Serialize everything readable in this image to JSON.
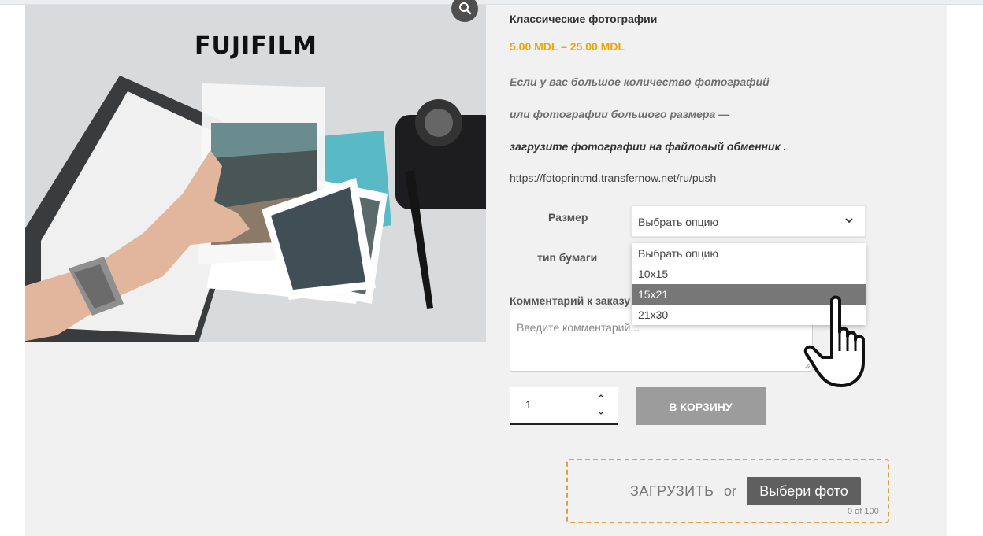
{
  "product": {
    "title": "Классические фотографии",
    "price": "5.00 MDL – 25.00 MDL",
    "info_line1": "Если у вас большое количество фотографий",
    "info_line2": "или фотографии большого размера —",
    "info_line3": "загрузите фотографии на файловый обменник .",
    "upload_link": "https://fotoprintmd.transfernow.net/ru/push",
    "image_logo_text": "FUJIFILM"
  },
  "options": {
    "size_label": "Размер",
    "size_selected": "Выбрать опцию",
    "paper_label": "тип бумаги",
    "dropdown": [
      "Выбрать опцию",
      "10x15",
      "15x21",
      "21x30"
    ],
    "dropdown_highlighted_index": 2
  },
  "comment": {
    "label": "Комментарий к заказу",
    "placeholder": "Введите комментарий..."
  },
  "cart": {
    "quantity": "1",
    "add_label": "В КОРЗИНУ"
  },
  "upload": {
    "label": "ЗАГРУЗИТЬ",
    "or": "or",
    "button": "Выбери фото",
    "count": "0 of 100"
  },
  "colors": {
    "price": "#f0a500",
    "panel": "#f1f1f1",
    "highlight": "#777777",
    "dashed_border": "#e0a040"
  },
  "icons": [
    "search-icon",
    "chevron-down-icon",
    "chevron-up-icon",
    "hand-pointer-icon"
  ]
}
